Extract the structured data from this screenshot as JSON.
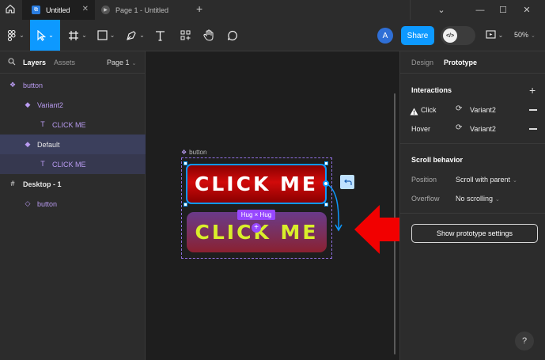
{
  "titlebar": {
    "tabs": [
      {
        "label": "Untitled",
        "icon": "figma-file-icon"
      },
      {
        "label": "Page 1 - Untitled",
        "icon": "play-icon"
      }
    ],
    "new_tab": "+",
    "window_controls": [
      "chevron-down-icon",
      "minimize-icon",
      "maximize-icon",
      "close-icon"
    ]
  },
  "toolbar": {
    "tools": [
      "main-menu-icon",
      "move-tool-icon",
      "frame-tool-icon",
      "shape-tool-icon",
      "pen-tool-icon",
      "text-tool-icon",
      "resources-icon",
      "hand-tool-icon",
      "comment-icon"
    ],
    "avatar_initial": "A",
    "share_label": "Share",
    "dev_mode_glyph": "</>",
    "zoom": "50%"
  },
  "left_panel": {
    "tab_layers": "Layers",
    "tab_assets": "Assets",
    "page": "Page 1",
    "layers": [
      {
        "name": "button",
        "type": "component-set"
      },
      {
        "name": "Variant2",
        "type": "variant"
      },
      {
        "name": "CLICK ME",
        "type": "text"
      },
      {
        "name": "Default",
        "type": "variant"
      },
      {
        "name": "CLICK ME",
        "type": "text"
      },
      {
        "name": "Desktop - 1",
        "type": "frame"
      },
      {
        "name": "button",
        "type": "instance"
      }
    ]
  },
  "canvas": {
    "frame_label": "button",
    "button_default_text": "CLICK ME",
    "button_variant_text": "CLICK ME",
    "hug_label": "Hug × Hug",
    "accent_blue": "#0d99ff",
    "component_purple": "#9747ff",
    "annotation_arrow_color": "#ff0000"
  },
  "right_panel": {
    "tab_design": "Design",
    "tab_prototype": "Prototype",
    "interactions_title": "Interactions",
    "interactions": [
      {
        "trigger": "Click",
        "target": "Variant2",
        "warning": true
      },
      {
        "trigger": "Hover",
        "target": "Variant2",
        "warning": false
      }
    ],
    "scroll_title": "Scroll behavior",
    "position_label": "Position",
    "position_value": "Scroll with parent",
    "overflow_label": "Overflow",
    "overflow_value": "No scrolling",
    "show_settings_label": "Show prototype settings",
    "help": "?"
  }
}
